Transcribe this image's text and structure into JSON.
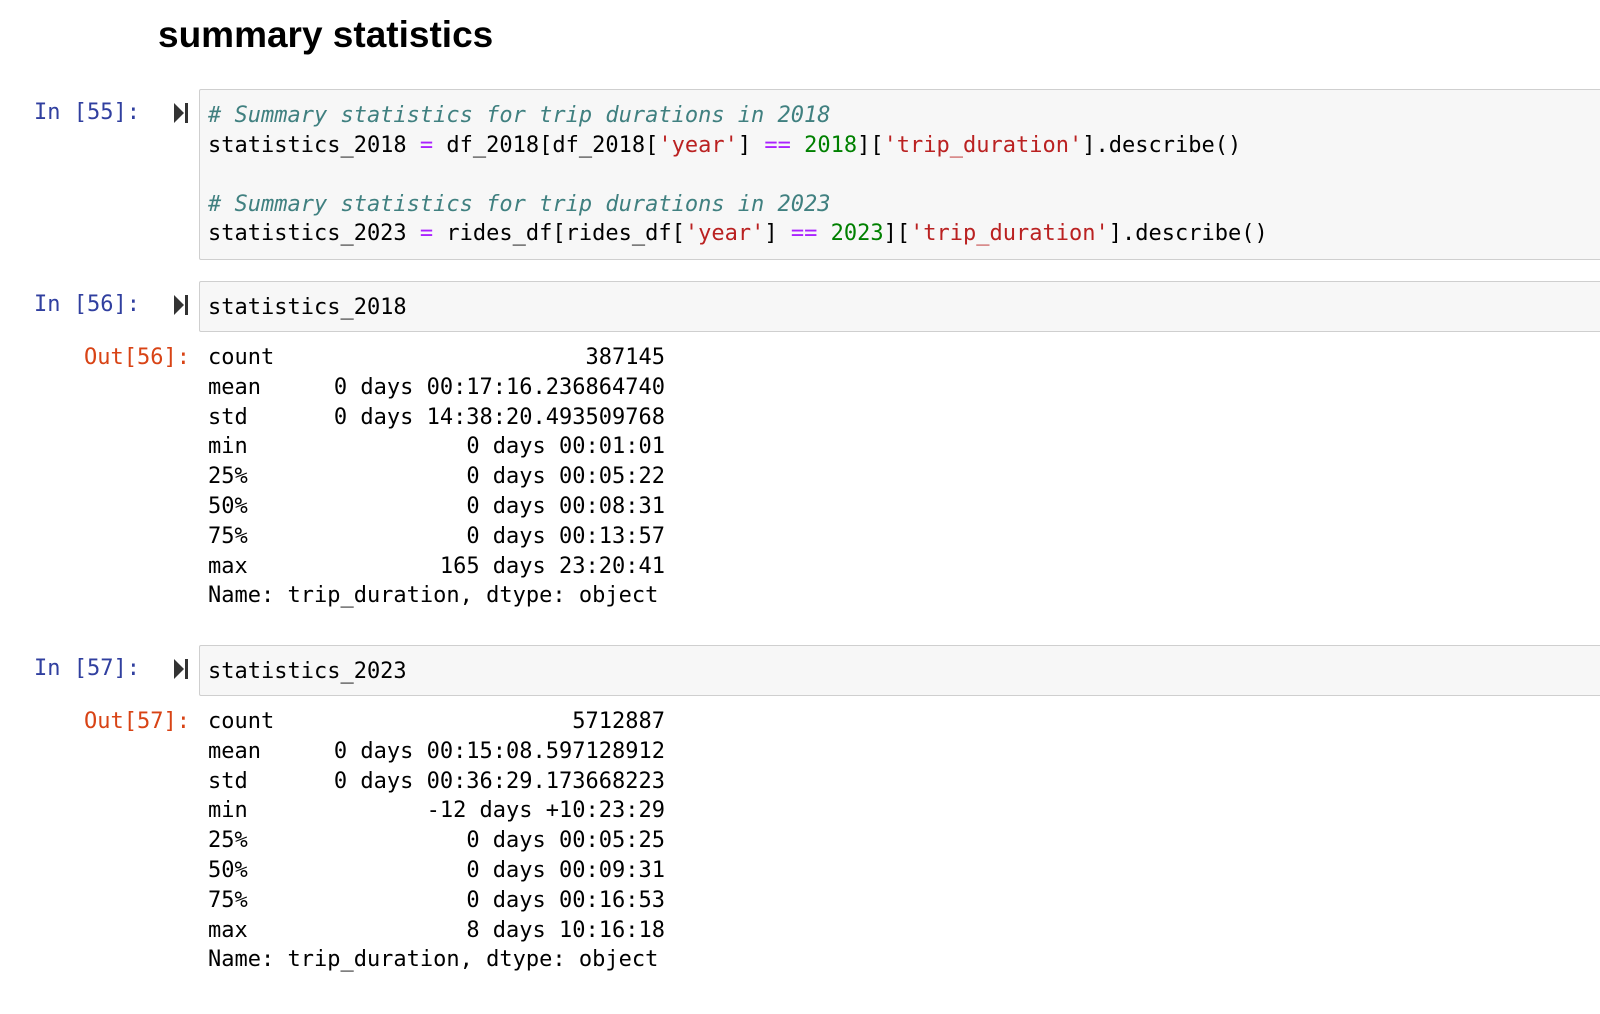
{
  "heading": "summary statistics",
  "cells": {
    "c55": {
      "prompt": "In [55]:",
      "lines": [
        [
          {
            "t": "# Summary statistics for trip durations in 2018",
            "c": "cm"
          }
        ],
        [
          {
            "t": "statistics_2018 ",
            "c": ""
          },
          {
            "t": "=",
            "c": "op"
          },
          {
            "t": " df_2018[df_2018[",
            "c": ""
          },
          {
            "t": "'year'",
            "c": "str"
          },
          {
            "t": "] ",
            "c": ""
          },
          {
            "t": "==",
            "c": "op"
          },
          {
            "t": " ",
            "c": ""
          },
          {
            "t": "2018",
            "c": "num"
          },
          {
            "t": "][",
            "c": ""
          },
          {
            "t": "'trip_duration'",
            "c": "str"
          },
          {
            "t": "].describe()",
            "c": ""
          }
        ],
        [],
        [
          {
            "t": "# Summary statistics for trip durations in 2023",
            "c": "cm"
          }
        ],
        [
          {
            "t": "statistics_2023 ",
            "c": ""
          },
          {
            "t": "=",
            "c": "op"
          },
          {
            "t": " rides_df[rides_df[",
            "c": ""
          },
          {
            "t": "'year'",
            "c": "str"
          },
          {
            "t": "] ",
            "c": ""
          },
          {
            "t": "==",
            "c": "op"
          },
          {
            "t": " ",
            "c": ""
          },
          {
            "t": "2023",
            "c": "num"
          },
          {
            "t": "][",
            "c": ""
          },
          {
            "t": "'trip_duration'",
            "c": "str"
          },
          {
            "t": "].describe()",
            "c": ""
          }
        ]
      ]
    },
    "c56": {
      "prompt": "In [56]:",
      "code": "statistics_2018",
      "out_prompt": "Out[56]:",
      "rows": [
        {
          "k": "count",
          "v": "387145"
        },
        {
          "k": "mean",
          "v": "0 days 00:17:16.236864740"
        },
        {
          "k": "std",
          "v": "0 days 14:38:20.493509768"
        },
        {
          "k": "min",
          "v": "0 days 00:01:01"
        },
        {
          "k": "25%",
          "v": "0 days 00:05:22"
        },
        {
          "k": "50%",
          "v": "0 days 00:08:31"
        },
        {
          "k": "75%",
          "v": "0 days 00:13:57"
        },
        {
          "k": "max",
          "v": "165 days 23:20:41"
        }
      ],
      "footer": "Name: trip_duration, dtype: object"
    },
    "c57": {
      "prompt": "In [57]:",
      "code": "statistics_2023",
      "out_prompt": "Out[57]:",
      "rows": [
        {
          "k": "count",
          "v": "5712887"
        },
        {
          "k": "mean",
          "v": "0 days 00:15:08.597128912"
        },
        {
          "k": "std",
          "v": "0 days 00:36:29.173668223"
        },
        {
          "k": "min",
          "v": "-12 days +10:23:29"
        },
        {
          "k": "25%",
          "v": "0 days 00:05:25"
        },
        {
          "k": "50%",
          "v": "0 days 00:09:31"
        },
        {
          "k": "75%",
          "v": "0 days 00:16:53"
        },
        {
          "k": "max",
          "v": "8 days 10:16:18"
        }
      ],
      "footer": "Name: trip_duration, dtype: object"
    }
  }
}
